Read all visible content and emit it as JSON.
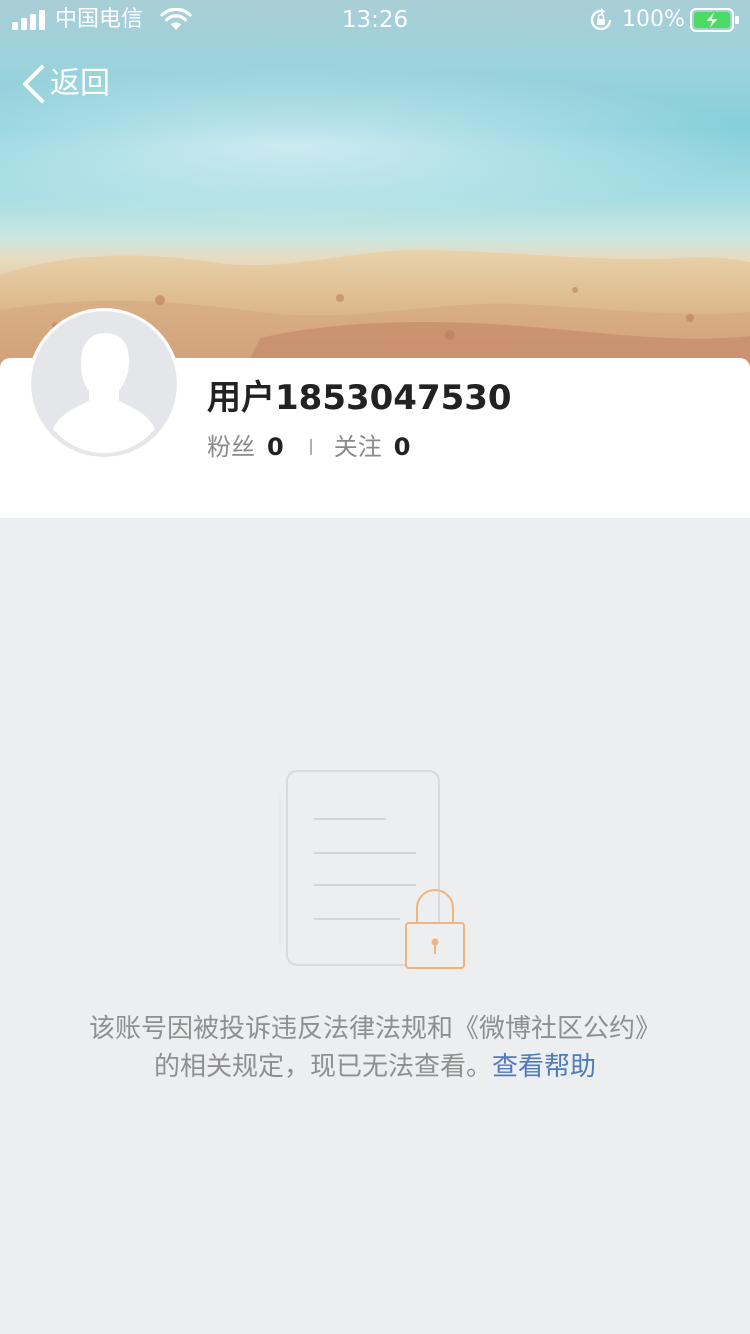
{
  "status_bar": {
    "carrier": "中国电信",
    "time": "13:26",
    "battery_percent": "100%"
  },
  "nav": {
    "back_label": "返回"
  },
  "profile": {
    "username": "用户1853047530",
    "followers_label": "粉丝",
    "followers_count": "0",
    "following_label": "关注",
    "following_count": "0"
  },
  "blocked": {
    "message": "该账号因被投诉违反法律法规和《微博社区公约》的相关规定，现已无法查看。",
    "help_link": "查看帮助"
  },
  "colors": {
    "link": "#4f7bbd",
    "page_background": "#eceef0",
    "lock_accent": "#f4b37a",
    "battery_green": "#4cd964"
  }
}
